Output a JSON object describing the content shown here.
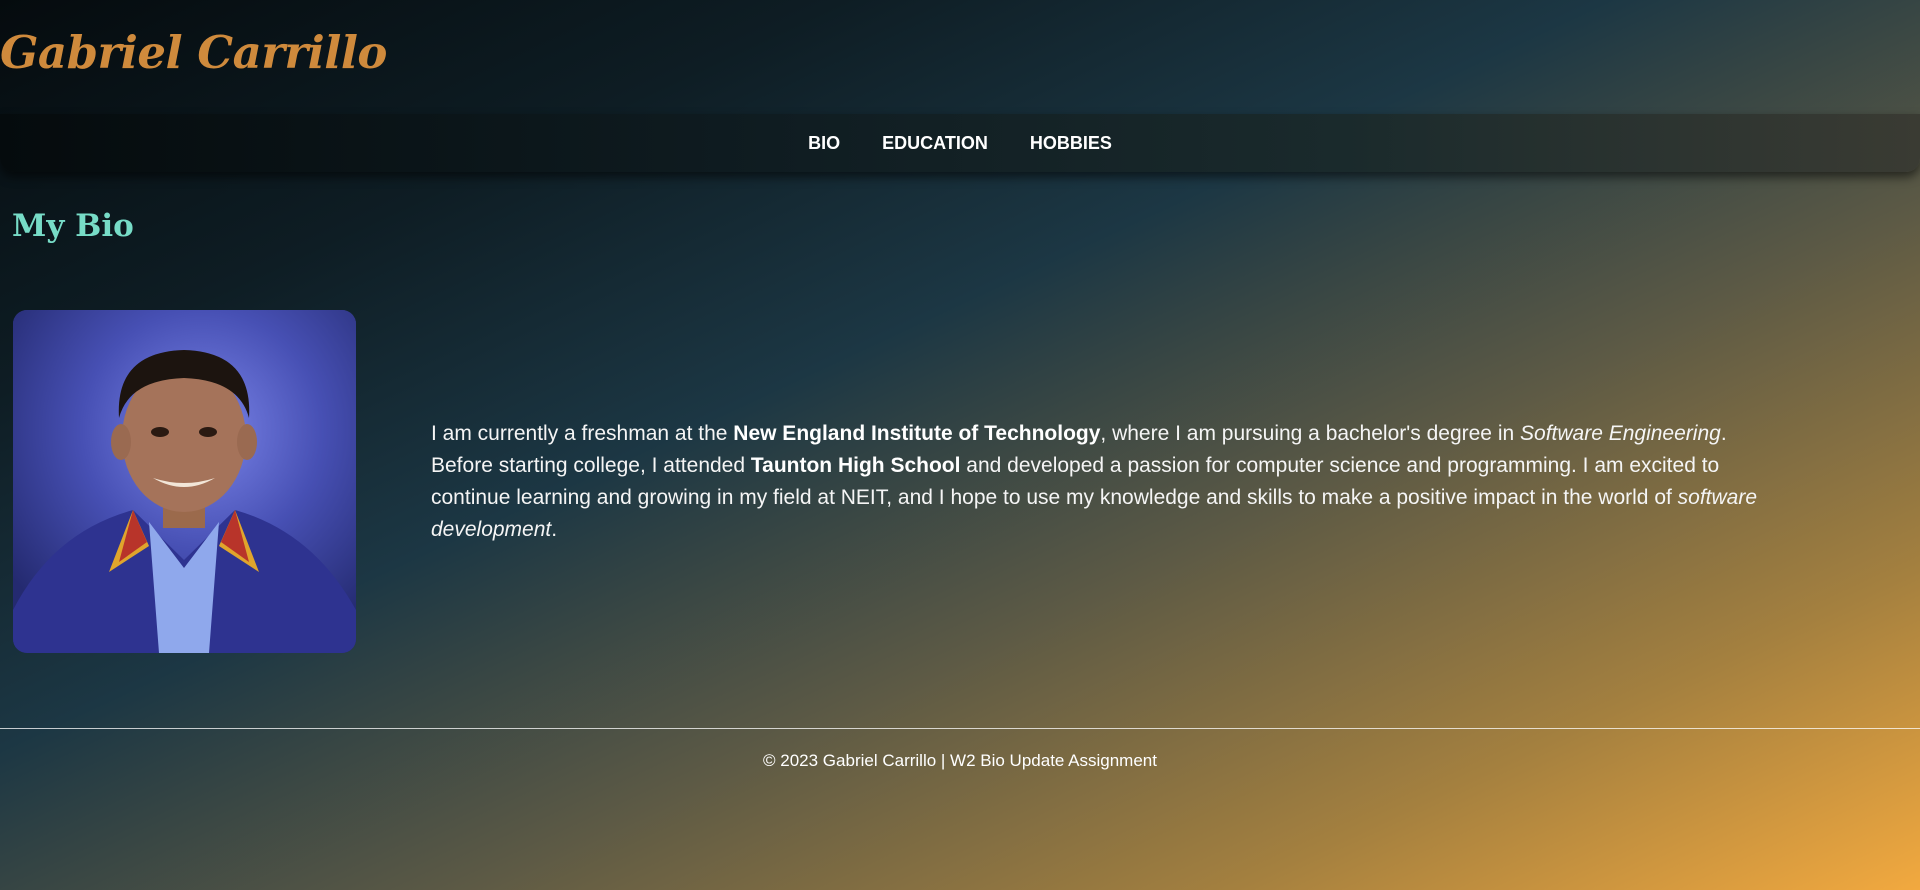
{
  "header": {
    "site_title": "Gabriel Carrillo"
  },
  "nav": {
    "items": [
      {
        "label": "BIO"
      },
      {
        "label": "EDUCATION"
      },
      {
        "label": "HOBBIES"
      }
    ]
  },
  "main": {
    "heading": "My Bio",
    "portrait_alt": "Photo of Gabriel Carrillo",
    "bio": {
      "part1": "I am currently a freshman at the ",
      "school1": "New England Institute of Technology",
      "part2": ", where I am pursuing a bachelor's degree in ",
      "degree": "Software Engineering",
      "part3": ". Before starting college, I attended ",
      "school2": "Taunton High School",
      "part4": " and developed a passion for computer science and programming. I am excited to continue learning and growing in my field at NEIT, and I hope to use my knowledge and skills to make a positive impact in the world of ",
      "field": "software development",
      "part5": "."
    }
  },
  "footer": {
    "text": "© 2023 Gabriel Carrillo | W2 Bio Update Assignment"
  },
  "colors": {
    "title": "#cf8a3c",
    "heading": "#77dcc7",
    "text": "#f5f5f5"
  }
}
